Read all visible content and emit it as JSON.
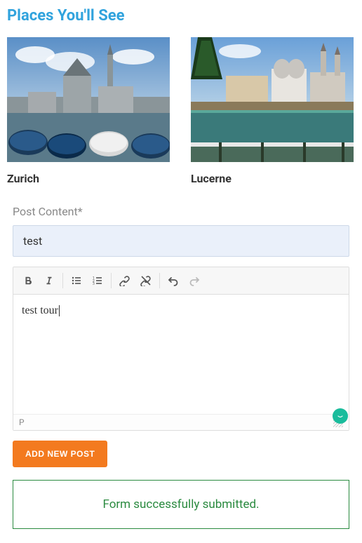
{
  "section_title": "Places You'll See",
  "places": [
    {
      "name": "Zurich"
    },
    {
      "name": "Lucerne"
    }
  ],
  "form": {
    "content_label": "Post Content*",
    "content_value": "test",
    "editor_text": "test tour",
    "path_indicator": "P",
    "submit_label": "ADD NEW POST"
  },
  "toolbar": {
    "bold": "bold-icon",
    "italic": "italic-icon",
    "ul": "bullet-list-icon",
    "ol": "numbered-list-icon",
    "link": "link-icon",
    "unlink": "unlink-icon",
    "undo": "undo-icon",
    "redo": "redo-icon"
  },
  "success_message": "Form successfully submitted."
}
